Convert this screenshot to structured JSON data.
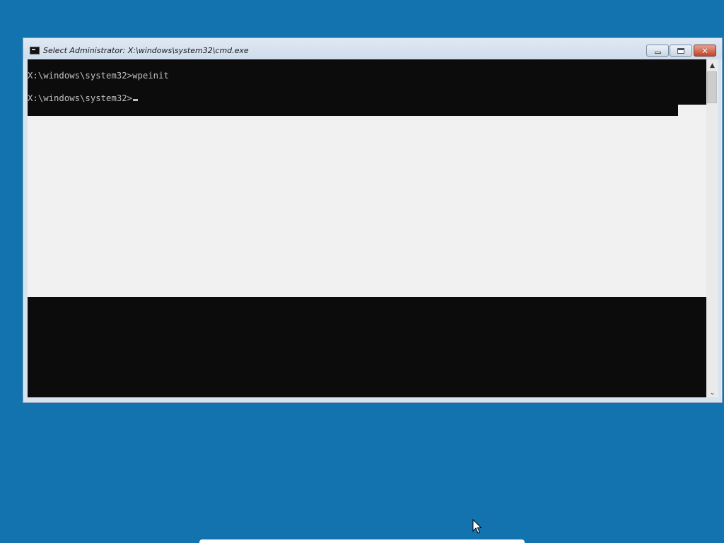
{
  "window": {
    "title": "Select Administrator: X:\\windows\\system32\\cmd.exe",
    "icon": "cmd-icon",
    "controls": {
      "minimize": "minimize-icon",
      "maximize": "maximize-icon",
      "close_glyph": "✕"
    }
  },
  "console": {
    "lines": [
      "X:\\windows\\system32>wpeinit",
      "X:\\windows\\system32>"
    ],
    "text_color": "#c0c0c0",
    "background_color": "#0c0c0c"
  },
  "scrollbar": {
    "up_glyph": "▲",
    "down_glyph": "⌄"
  },
  "desktop": {
    "background_color": "#1373ae"
  },
  "colors": {
    "close_button": "#c2412a",
    "title_bar": "#d6e3f0"
  }
}
